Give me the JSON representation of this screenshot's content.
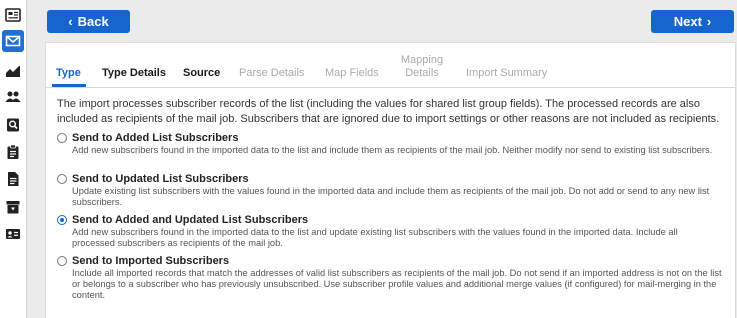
{
  "sidebar": {
    "items": [
      {
        "icon": "newspaper-icon",
        "label": "Newsletters"
      },
      {
        "icon": "envelope-icon",
        "label": "Mail Jobs",
        "active": true
      },
      {
        "icon": "chart-icon",
        "label": "Reports"
      },
      {
        "icon": "people-icon",
        "label": "Subscribers"
      },
      {
        "icon": "search-doc-icon",
        "label": "Search"
      },
      {
        "icon": "clipboard-icon",
        "label": "Lists"
      },
      {
        "icon": "document-icon",
        "label": "Documents"
      },
      {
        "icon": "archive-icon",
        "label": "Archive"
      },
      {
        "icon": "contact-card-icon",
        "label": "Contacts"
      }
    ]
  },
  "nav": {
    "back_label": "Back",
    "next_label": "Next"
  },
  "tabs": [
    {
      "label": "Type",
      "state": "active"
    },
    {
      "label": "Type Details",
      "state": "enabled"
    },
    {
      "label": "Source",
      "state": "enabled"
    },
    {
      "label": "Parse Details",
      "state": "disabled"
    },
    {
      "label": "Map Fields",
      "state": "disabled"
    },
    {
      "label": "Mapping Details",
      "state": "disabled"
    },
    {
      "label": "Import Summary",
      "state": "disabled"
    }
  ],
  "intro": "The import processes subscriber records of the list (including the values for shared list group fields). The processed records are also included as recipients of the mail job. Subscribers that are ignored due to import settings or other reasons are not included as recipients.",
  "options": [
    {
      "title": "Send to Added List Subscribers",
      "description": "Add new subscribers found in the imported data to the list and include them as recipients of the mail job. Neither modify nor send to existing list subscribers.",
      "checked": false
    },
    {
      "title": "Send to Updated List Subscribers",
      "description": "Update existing list subscribers with the values found in the imported data and include them as recipients of the mail job. Do not add or send to any new list subscribers.",
      "checked": false
    },
    {
      "title": "Send to Added and Updated List Subscribers",
      "description": "Add new subscribers found in the imported data to the list and update existing list subscribers with the values found in the imported data. Include all processed subscribers as recipients of the mail job.",
      "checked": true
    },
    {
      "title": "Send to Imported Subscribers",
      "description": "Include all imported records that match the addresses of valid list subscribers as recipients of the mail job. Do not send if an imported address is not on the list or belongs to a subscriber who has previously unsubscribed. Use subscriber profile values and additional merge values (if configured) for mail-merging in the content.",
      "checked": false
    }
  ],
  "colors": {
    "accent": "#1665cf",
    "disabled_tab": "#aaaaaa"
  }
}
